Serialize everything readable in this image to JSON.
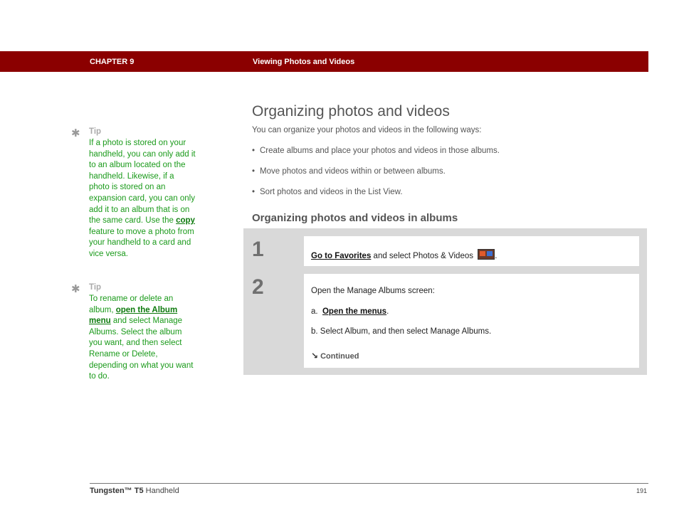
{
  "header": {
    "chapter": "CHAPTER 9",
    "section": "Viewing Photos and Videos"
  },
  "colors": {
    "header_bar": "#8b0000",
    "tip_text": "#1a9a1a",
    "steps_background": "#d9d9d9"
  },
  "main": {
    "title": "Organizing photos and videos",
    "intro": "You can organize your photos and videos in the following ways:",
    "bullets": [
      "Create albums and place your photos and videos in those albums.",
      "Move photos and videos within or between albums.",
      "Sort photos and videos in the List View."
    ],
    "subheading": "Organizing photos and videos in albums"
  },
  "steps": [
    {
      "number": "1",
      "link": "Go to Favorites",
      "text_after_link": " and select Photos & Videos ",
      "icon": "photos-videos-icon",
      "end": "."
    },
    {
      "number": "2",
      "lead": "Open the Manage Albums screen:",
      "a_prefix": "a.",
      "a_link": "Open the menus",
      "a_end": ".",
      "b_text": "b.  Select Album, and then select Manage Albums.",
      "continued": "Continued"
    }
  ],
  "sidebar": {
    "tips": [
      {
        "label": "Tip",
        "text_before": "If a photo is stored on your handheld, you can only add it to an album located on the handheld. Likewise, if a photo is stored on an expansion card, you can only add it to an album that is on the same card. Use the ",
        "link": "copy",
        "text_after": " feature to move a photo from your handheld to a card and vice versa."
      },
      {
        "label": "Tip",
        "text_before": "To rename or delete an album, ",
        "link": "open the Album menu",
        "text_after": " and select Manage Albums. Select the album you want, and then select Rename or Delete, depending on what you want to do."
      }
    ]
  },
  "footer": {
    "product_bold": "Tungsten™ T5",
    "product_rest": " Handheld",
    "page_number": "191"
  }
}
